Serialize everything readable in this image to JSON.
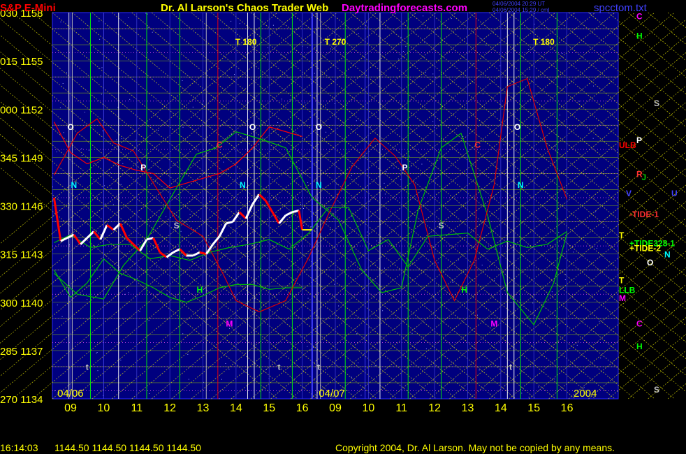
{
  "header": {
    "instrument": "S&P E-Mini",
    "title": "Dr. Al Larson's Chaos Trader Web",
    "site": "Daytradingforecasts.com",
    "stamp_1": "04/06/2004 20:29 UT",
    "stamp_2": "04/06/2004 15:29 / cml",
    "file": "spcctom.txt"
  },
  "footer": {
    "time": "16:14:03",
    "quote": "1144.50 1144.50 1144.50 1144.50",
    "copyright": "Copyright 2004, Dr. Al Larson. May not be copied by any means."
  },
  "colors": {
    "background": "#00007f",
    "price_up": "#ffffff",
    "price_down": "#ff0000",
    "forecast": "#00c000",
    "ulb": "#ff0000",
    "llb": "#00c000",
    "harmonic_lines": "#ffff00",
    "time_lines": "#00ff00"
  },
  "chart_data": {
    "type": "line",
    "title": "S&P E-Mini",
    "y_range": [
      1134,
      1158
    ],
    "y_ticks": [
      {
        "deg": "030",
        "price": "1158",
        "value": 1158
      },
      {
        "deg": "015",
        "price": "1155",
        "value": 1155
      },
      {
        "deg": "000",
        "price": "1152",
        "value": 1152
      },
      {
        "deg": "345",
        "price": "1149",
        "value": 1149
      },
      {
        "deg": "330",
        "price": "1146",
        "value": 1146
      },
      {
        "deg": "315",
        "price": "1143",
        "value": 1143
      },
      {
        "deg": "300",
        "price": "1140",
        "value": 1140
      },
      {
        "deg": "285",
        "price": "1137",
        "value": 1137
      },
      {
        "deg": "270",
        "price": "1134",
        "value": 1134
      }
    ],
    "x_range": [
      8.45,
      25.55
    ],
    "x_ticks": [
      {
        "label": "09",
        "value": 9
      },
      {
        "label": "10",
        "value": 10
      },
      {
        "label": "11",
        "value": 11
      },
      {
        "label": "12",
        "value": 12
      },
      {
        "label": "13",
        "value": 13
      },
      {
        "label": "14",
        "value": 14
      },
      {
        "label": "15",
        "value": 15
      },
      {
        "label": "16",
        "value": 16
      },
      {
        "label": "09",
        "value": 17
      },
      {
        "label": "10",
        "value": 18
      },
      {
        "label": "11",
        "value": 19
      },
      {
        "label": "12",
        "value": 20
      },
      {
        "label": "13",
        "value": 21
      },
      {
        "label": "14",
        "value": 22
      },
      {
        "label": "15",
        "value": 23
      },
      {
        "label": "16",
        "value": 24
      }
    ],
    "dates": [
      {
        "label": "04/06",
        "x": 8.6
      },
      {
        "label": "04/07",
        "x": 16.5
      },
      {
        "label": "2004",
        "x": 24.2
      }
    ],
    "price_series": {
      "name": "S&P E-Mini",
      "x": [
        8.5,
        8.7,
        8.9,
        9.1,
        9.3,
        9.5,
        9.7,
        9.9,
        10.1,
        10.3,
        10.5,
        10.7,
        10.9,
        11.1,
        11.3,
        11.5,
        11.7,
        11.9,
        12.1,
        12.3,
        12.5,
        12.7,
        12.9,
        13.1,
        13.3,
        13.5,
        13.7,
        13.9,
        14.1,
        14.3,
        14.5,
        14.7,
        14.9,
        15.1,
        15.3,
        15.5,
        15.7,
        15.9,
        16.0
      ],
      "close": [
        1146.5,
        1143.8,
        1144.0,
        1144.2,
        1143.6,
        1144.0,
        1144.4,
        1143.9,
        1144.8,
        1144.5,
        1144.9,
        1144.0,
        1143.6,
        1143.2,
        1143.9,
        1144.0,
        1143.1,
        1142.8,
        1143.1,
        1143.3,
        1142.9,
        1142.9,
        1143.1,
        1143.0,
        1143.6,
        1144.1,
        1144.9,
        1145.0,
        1145.6,
        1145.2,
        1146.1,
        1146.7,
        1146.3,
        1145.6,
        1144.9,
        1145.4,
        1145.6,
        1145.7,
        1144.5
      ]
    },
    "series": [
      {
        "name": "ULB",
        "x": [
          8.5,
          9.0,
          9.5,
          10.0,
          10.5,
          11.0,
          11.5,
          12.0,
          12.5,
          13.0,
          13.5,
          14.0,
          14.5,
          15.0,
          15.5,
          16.0
        ],
        "values": [
          1151.2,
          1149.3,
          1148.6,
          1149.0,
          1148.5,
          1148.2,
          1148.0,
          1147.1,
          1147.4,
          1147.7,
          1148.0,
          1148.6,
          1149.6,
          1150.9,
          1150.6,
          1150.3
        ]
      },
      {
        "name": "LLB",
        "x": [
          8.5,
          9.0,
          9.5,
          10.0,
          10.5,
          11.0,
          11.5,
          12.0,
          12.5,
          13.0,
          13.5,
          14.0,
          14.5,
          15.0,
          15.5,
          16.0
        ],
        "values": [
          1142.0,
          1140.3,
          1141.2,
          1142.7,
          1141.8,
          1141.4,
          1140.9,
          1140.3,
          1140.0,
          1140.4,
          1140.9,
          1141.1,
          1141.1,
          1140.8,
          1140.9,
          1140.9
        ]
      },
      {
        "name": "TIDE",
        "x": [
          8.5,
          9.2,
          10.0,
          10.6,
          11.3,
          12.0,
          12.8,
          13.4,
          14.0,
          14.8,
          15.5,
          16.3,
          17.1,
          17.8,
          18.4,
          19.0,
          19.5,
          20.2,
          20.8,
          21.6,
          22.2,
          23.0,
          23.6,
          24.0
        ],
        "values": [
          1141.8,
          1140.5,
          1140.2,
          1142.3,
          1143.9,
          1146.4,
          1149.2,
          1149.6,
          1150.6,
          1150.1,
          1149.6,
          1146.5,
          1145.1,
          1142.0,
          1140.6,
          1140.9,
          1145.7,
          1149.6,
          1150.5,
          1145.4,
          1140.6,
          1138.6,
          1141.2,
          1144.3
        ]
      },
      {
        "name": "-TIDE",
        "x": [
          8.5,
          9.2,
          9.8,
          10.3,
          10.9,
          11.5,
          12.2,
          13.0,
          13.6,
          14.0,
          14.7,
          15.5,
          16.2,
          16.8,
          17.5,
          18.2,
          18.8,
          19.4,
          20.0,
          20.6,
          21.2,
          21.8,
          22.2,
          22.8,
          23.4,
          24.0
        ],
        "values": [
          1147.9,
          1150.5,
          1151.4,
          1149.9,
          1149.4,
          1147.4,
          1145.1,
          1144.1,
          1141.8,
          1140.1,
          1139.4,
          1140.1,
          1142.8,
          1145.5,
          1148.4,
          1150.2,
          1149.1,
          1147.3,
          1142.6,
          1140.1,
          1142.6,
          1147.3,
          1153.4,
          1153.9,
          1149.6,
          1146.4
        ]
      },
      {
        "name": "+TIDE-2",
        "x": [
          8.5,
          9.0,
          9.6,
          10.2,
          10.8,
          11.4,
          12.0,
          12.6,
          13.2,
          13.8,
          14.4,
          15.0,
          15.6,
          16.2,
          16.8,
          17.4,
          18.0,
          18.6,
          19.2,
          19.8,
          20.4,
          21.0,
          21.6,
          22.2,
          22.8,
          23.4,
          24.0
        ],
        "values": [
          1143.7,
          1144.2,
          1143.4,
          1143.6,
          1143.6,
          1142.7,
          1142.9,
          1142.6,
          1143.1,
          1143.4,
          1143.6,
          1143.9,
          1143.3,
          1144.3,
          1145.9,
          1145.9,
          1143.2,
          1143.9,
          1142.2,
          1144.1,
          1144.2,
          1144.3,
          1143.3,
          1143.8,
          1143.4,
          1143.6,
          1144.4
        ]
      }
    ],
    "annotations": [
      {
        "text": "O",
        "x": 9.0,
        "y": 1150.7,
        "color": "#ffffff"
      },
      {
        "text": "O",
        "x": 14.5,
        "y": 1150.7,
        "color": "#ffffff"
      },
      {
        "text": "O",
        "x": 16.5,
        "y": 1150.7,
        "color": "#ffffff"
      },
      {
        "text": "O",
        "x": 22.5,
        "y": 1150.7,
        "color": "#ffffff"
      },
      {
        "text": "N",
        "x": 9.1,
        "y": 1147.1,
        "color": "#00ffff"
      },
      {
        "text": "N",
        "x": 14.2,
        "y": 1147.1,
        "color": "#00ffff"
      },
      {
        "text": "N",
        "x": 16.5,
        "y": 1147.1,
        "color": "#00ffff"
      },
      {
        "text": "N",
        "x": 22.6,
        "y": 1147.1,
        "color": "#00ffff"
      },
      {
        "text": "P",
        "x": 11.2,
        "y": 1148.2,
        "color": "#ffffff"
      },
      {
        "text": "P",
        "x": 19.1,
        "y": 1148.2,
        "color": "#ffffff"
      },
      {
        "text": "C",
        "x": 13.5,
        "y": 1149.6,
        "color": "#ff3030"
      },
      {
        "text": "C",
        "x": 21.3,
        "y": 1149.6,
        "color": "#ff3030"
      },
      {
        "text": "S",
        "x": 12.2,
        "y": 1144.6,
        "color": "#c0c0c0"
      },
      {
        "text": "S",
        "x": 20.2,
        "y": 1144.6,
        "color": "#c0c0c0"
      },
      {
        "text": "H",
        "x": 12.9,
        "y": 1140.6,
        "color": "#00ff00"
      },
      {
        "text": "H",
        "x": 20.9,
        "y": 1140.6,
        "color": "#00ff00"
      },
      {
        "text": "M",
        "x": 13.8,
        "y": 1138.5,
        "color": "#ff00ff"
      },
      {
        "text": "M",
        "x": 21.8,
        "y": 1138.5,
        "color": "#ff00ff"
      },
      {
        "text": "t",
        "x": 9.5,
        "y": 1135.8,
        "color": "#c0c0c0"
      },
      {
        "text": "t",
        "x": 15.3,
        "y": 1135.8,
        "color": "#c0c0c0"
      },
      {
        "text": "t",
        "x": 16.5,
        "y": 1135.8,
        "color": "#c0c0c0"
      },
      {
        "text": "t",
        "x": 22.3,
        "y": 1135.8,
        "color": "#c0c0c0"
      },
      {
        "text": "T 180",
        "x": 14.3,
        "y": 1156.0,
        "color": "#ffff00"
      },
      {
        "text": "T 270",
        "x": 17.0,
        "y": 1156.0,
        "color": "#ffff00"
      },
      {
        "text": "T 180",
        "x": 23.3,
        "y": 1156.0,
        "color": "#ffff00"
      }
    ],
    "right_labels": [
      {
        "text": "C",
        "color": "#ff00ff",
        "y": 1157.8,
        "col": 1
      },
      {
        "text": "H",
        "color": "#00ff00",
        "y": 1156.6,
        "col": 1
      },
      {
        "text": "S",
        "color": "#c0c0c0",
        "y": 1152.4,
        "col": 2
      },
      {
        "text": "ULB",
        "color": "#ff0000",
        "y": 1149.8,
        "col": 0
      },
      {
        "text": "P",
        "color": "#ffffff",
        "y": 1150.1,
        "col": 1
      },
      {
        "text": "R",
        "color": "#ff3030",
        "y": 1148.0,
        "col": 1
      },
      {
        "text": "J",
        "color": "#00c000",
        "y": 1147.8,
        "col": 1.3
      },
      {
        "text": "V",
        "color": "#4040ff",
        "y": 1146.8,
        "col": 0.4
      },
      {
        "text": "U",
        "color": "#4040ff",
        "y": 1146.8,
        "col": 3
      },
      {
        "text": "-TIDE-1",
        "color": "#ff3030",
        "y": 1145.5,
        "col": 0.6
      },
      {
        "text": "T",
        "color": "#ffff00",
        "y": 1144.2,
        "col": 0
      },
      {
        "text": "+TIDE328-1",
        "color": "#00ff00",
        "y": 1143.7,
        "col": 0.6
      },
      {
        "text": "+TIDE-2",
        "color": "#ffff00",
        "y": 1143.4,
        "col": 0.6
      },
      {
        "text": "N",
        "color": "#00ffff",
        "y": 1143.0,
        "col": 2.6
      },
      {
        "text": "O",
        "color": "#ffffff",
        "y": 1142.5,
        "col": 1.6
      },
      {
        "text": "T",
        "color": "#ffff00",
        "y": 1141.4,
        "col": 0
      },
      {
        "text": "LLB",
        "color": "#00ff00",
        "y": 1140.8,
        "col": 0
      },
      {
        "text": "M",
        "color": "#ff00ff",
        "y": 1140.3,
        "col": 0
      },
      {
        "text": "C",
        "color": "#ff00ff",
        "y": 1138.7,
        "col": 1
      },
      {
        "text": "H",
        "color": "#00ff00",
        "y": 1137.3,
        "col": 1
      },
      {
        "text": "S",
        "color": "#c0c0c0",
        "y": 1134.6,
        "col": 2
      }
    ],
    "time_lines": [
      {
        "x": 8.95,
        "color": "#ffffff"
      },
      {
        "x": 9.05,
        "color": "#c0c0c0"
      },
      {
        "x": 9.6,
        "color": "#00ff00"
      },
      {
        "x": 10.0,
        "color": "#4040ff"
      },
      {
        "x": 10.45,
        "color": "#ffffff"
      },
      {
        "x": 11.3,
        "color": "#00ff00"
      },
      {
        "x": 12.3,
        "color": "#00ff00"
      },
      {
        "x": 13.1,
        "color": "#c0c0c0"
      },
      {
        "x": 13.45,
        "color": "#ff0000"
      },
      {
        "x": 14.35,
        "color": "#ffffff"
      },
      {
        "x": 14.55,
        "color": "#ffffff"
      },
      {
        "x": 14.75,
        "color": "#00ff00"
      },
      {
        "x": 15.7,
        "color": "#00ff00"
      },
      {
        "x": 16.45,
        "color": "#ffffff"
      },
      {
        "x": 16.55,
        "color": "#c0c0c0"
      },
      {
        "x": 17.3,
        "color": "#00ff00"
      },
      {
        "x": 17.9,
        "color": "#4040ff"
      },
      {
        "x": 18.35,
        "color": "#ffffff"
      },
      {
        "x": 19.2,
        "color": "#00ff00"
      },
      {
        "x": 20.2,
        "color": "#00ff00"
      },
      {
        "x": 21.25,
        "color": "#ff0000"
      },
      {
        "x": 22.2,
        "color": "#ffffff"
      },
      {
        "x": 22.4,
        "color": "#ffffff"
      },
      {
        "x": 22.6,
        "color": "#00ff00"
      },
      {
        "x": 23.7,
        "color": "#00ff00"
      }
    ],
    "grid": true
  }
}
